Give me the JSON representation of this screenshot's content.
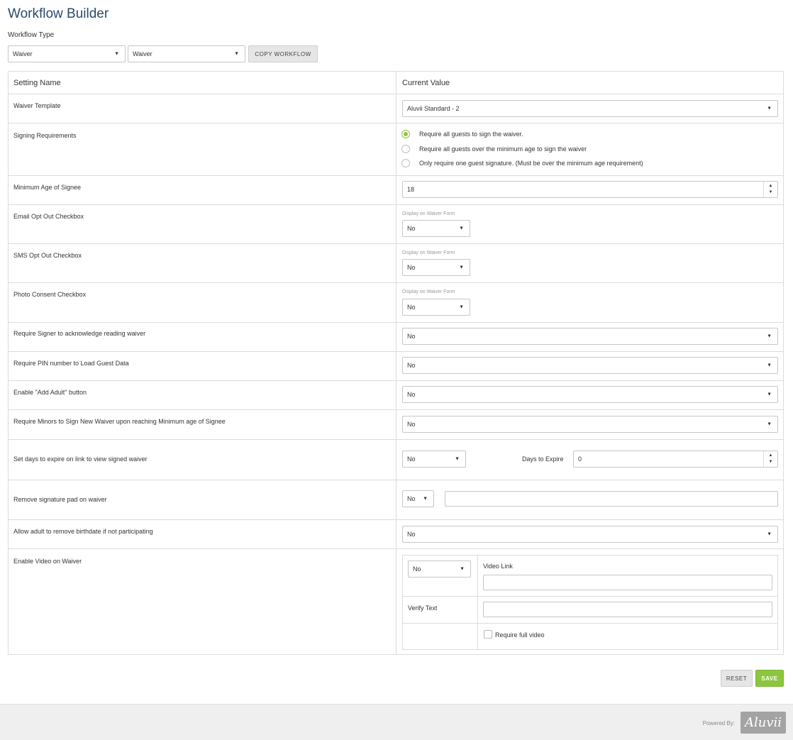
{
  "page": {
    "title": "Workflow Builder"
  },
  "workflow_type": {
    "label": "Workflow Type",
    "select1": "Waiver",
    "select2": "Waiver",
    "copy_button": "COPY WORKFLOW"
  },
  "table": {
    "headers": {
      "setting": "Setting Name",
      "value": "Current Value"
    },
    "rows": {
      "waiver_template": {
        "label": "Waiver Template",
        "value": "Aluvii Standard - 2"
      },
      "signing": {
        "label": "Signing Requirements",
        "options": [
          "Require all guests to sign the waiver.",
          "Require all guests over the minimum age to sign the waiver",
          "Only require one guest signature. (Must be over the minimum age requirement)"
        ],
        "selected_index": 0
      },
      "min_age": {
        "label": "Minimum Age of Signee",
        "value": "18"
      },
      "email_opt": {
        "label": "Email Opt Out Checkbox",
        "note": "Display on Waiver Form",
        "value": "No"
      },
      "sms_opt": {
        "label": "SMS Opt Out Checkbox",
        "note": "Display on Waiver Form",
        "value": "No"
      },
      "photo": {
        "label": "Photo Consent Checkbox",
        "note": "Display on Waiver Form",
        "value": "No"
      },
      "ack": {
        "label": "Require Signer to acknowledge reading waiver",
        "value": "No"
      },
      "pin": {
        "label": "Require PIN number to Load Guest Data",
        "value": "No"
      },
      "add_adult": {
        "label": "Enable \"Add Adult\" button",
        "value": "No"
      },
      "minors": {
        "label": "Require Minors to Sign New Waiver upon reaching Minimum age of Signee",
        "value": "No"
      },
      "expire": {
        "label": "Set days to expire on link to view signed waiver",
        "value": "No",
        "days_label": "Days to Expire",
        "days_value": "0"
      },
      "sigpad": {
        "label": "Remove signature pad on waiver",
        "value": "No",
        "text_value": ""
      },
      "birthdate": {
        "label": "Allow adult to remove birthdate if not participating",
        "value": "No"
      },
      "video": {
        "label": "Enable Video on Waiver",
        "value": "No",
        "link_label": "Video Link",
        "link_value": "",
        "verify_label": "Verify Text",
        "verify_value": "",
        "full_video_label": "Require full video",
        "full_video_checked": false
      }
    }
  },
  "actions": {
    "reset": "RESET",
    "save": "SAVE"
  },
  "footer": {
    "powered_by": "Powered By:",
    "logo_text": "Aluvii"
  },
  "colors": {
    "accent": "#8cc63f",
    "title": "#2c4a6b"
  }
}
